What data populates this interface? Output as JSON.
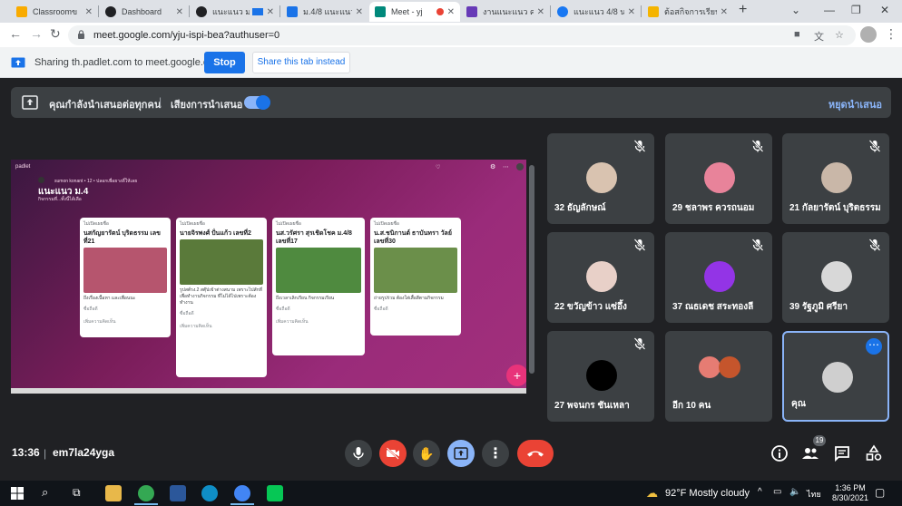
{
  "browser": {
    "tabs": [
      {
        "label": "Classroomข",
        "color": "#f9ab00"
      },
      {
        "label": "Dashboard",
        "color": "#202124"
      },
      {
        "label": "แนะแนว ม.",
        "color": "#202124"
      },
      {
        "label": "ม.4/8 แนะแนว",
        "color": "#1a73e8"
      },
      {
        "label": "Meet - yj",
        "color": "#00897b"
      },
      {
        "label": "งานแนะแนว ครั้",
        "color": "#673ab7"
      },
      {
        "label": "แนะแนว 4/8 น",
        "color": "#1877f2"
      },
      {
        "label": "ต้อสกิจการเรียนรู้",
        "color": "#f4b400"
      }
    ],
    "url": "meet.google.com/yju-ispi-bea?authuser=0"
  },
  "sharebar": {
    "text": "Sharing th.padlet.com to meet.google.com",
    "stop_label": "Stop",
    "share_tab_label": "Share this tab instead"
  },
  "meet": {
    "presenting_label": "คุณกำลังนำเสนอต่อทุกคน",
    "audio_label": "เสียงการนำเสนอ",
    "stop_presenting_label": "หยุดนำเสนอ",
    "padlet": {
      "logo": "padlet",
      "author": "sumon konant • 12 • ปลอกเพื่อยางดี๋ให้เลย",
      "title": "แนะแนว ม.4",
      "subtitle": "กิจกรรมที่...ทั้งนี้ได้เลือ",
      "cards": [
        {
          "header": "ไม่เปิดเผยชื่อ",
          "title": "นสกัญยารัตน์ บุริดธรรม เลขที่21",
          "desc": "ถึงเรื่องเนื้อหา และเพื่อนนะ",
          "img": "#b6556e"
        },
        {
          "header": "ไม่เปิดเผยชื่อ",
          "title": "นายจิรพงศ์ ปั่นแก้ว เลขที่2",
          "desc": "รูปสต์รง.2 สตุ๊ปเข้าต่างสนาม เพราะไปสักที่เพื่อทำงานกิจกรรม ที่ไม่ได้ไปเพราะต้องทำงาน",
          "img": "#5a7a3a"
        },
        {
          "header": "ไม่เปิดเผยชื่อ",
          "title": "นส.วรัศรา สุรเชิดโชค ม.4/8 เลขที่17",
          "desc": "ถึงเวลาเลิกเรียน กิจกรรมเรียน",
          "img": "#4f8a3f"
        },
        {
          "header": "ไม่เปิดเผยชื่อ",
          "title": "น.ส.ชนิกานต์ ธาบันทรา วัลย์ เลขที่30",
          "desc": "ถ่ายรูปร่วม ต้องใส่เสื้อสีตามกิจกรรม",
          "img": "#6b8f4a"
        }
      ],
      "card_like": "ซื่อถือดี",
      "card_comment": "เพิ่มความคิดเห็น"
    },
    "participants": [
      {
        "name": "32 ธัญลักษณ์",
        "avatar": "#d9c3b0",
        "muted": true
      },
      {
        "name": "29 ชลาพร ควรถนอม",
        "avatar": "#e8839a",
        "muted": true
      },
      {
        "name": "21 กัลยารัตน์ บุริตธรรม",
        "avatar": "#c9b7a8",
        "muted": true
      },
      {
        "name": "22 ขวัญข้าว แซ่อึ้ง",
        "avatar": "#e8d0c8",
        "muted": true
      },
      {
        "name": "37 ณธเดช สระทองลี",
        "avatar": "#9334e6",
        "muted": true
      },
      {
        "name": "39 รัฐภูมิ ศรียา",
        "avatar": "#d8d8d8",
        "muted": true
      },
      {
        "name": "27 พจนกร ชันเหลา",
        "avatar": "#000000",
        "muted": true
      },
      {
        "name": "อีก 10 คน",
        "avatar": "#e67c73",
        "muted": false
      },
      {
        "name": "คุณ",
        "avatar": "#cfcfcf",
        "muted": false
      }
    ],
    "clock": "13:36",
    "separator": "|",
    "meeting_code": "em7la24yga",
    "people_count": "19"
  },
  "taskbar": {
    "weather": "92°F  Mostly cloudy",
    "lang": "ไทย",
    "time": "1:36 PM",
    "date": "8/30/2021"
  },
  "colors": {
    "meet_bg": "#202124",
    "tile_bg": "#3c4043",
    "accent": "#1a73e8",
    "hangup": "#ea4335",
    "padlet_grad": "#9a2b7a"
  }
}
